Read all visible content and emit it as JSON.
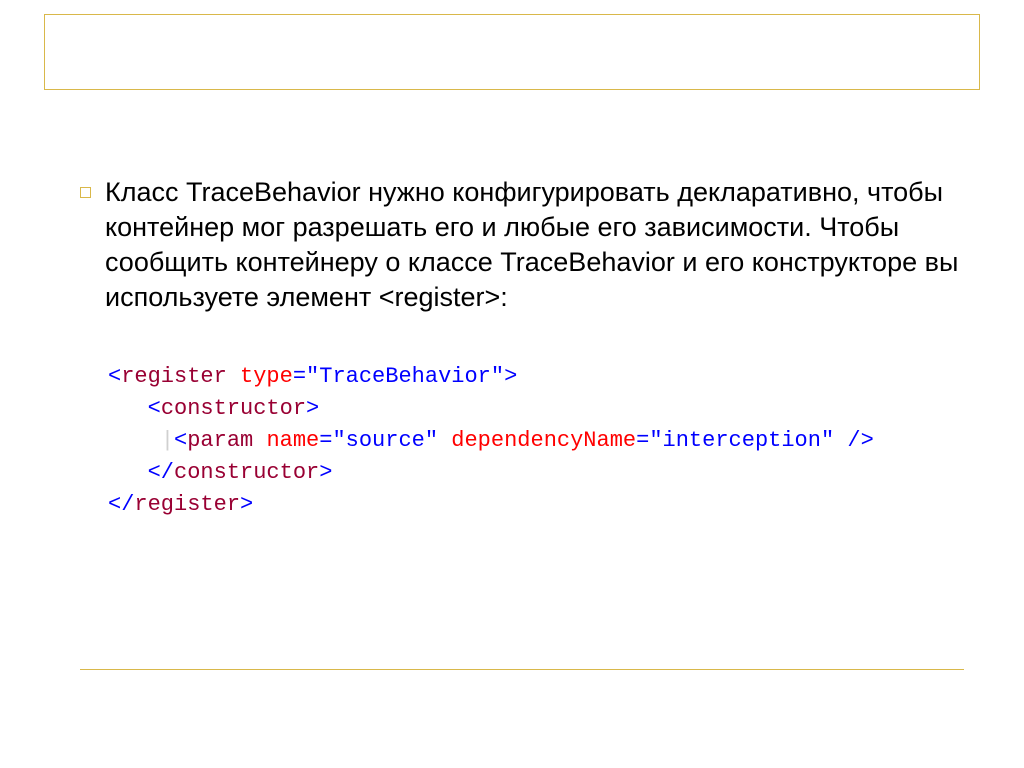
{
  "bullet": {
    "text": "Класс TraceBehavior нужно конфигурировать декларативно, чтобы контейнер мог разрешать его и любые его зависимости. Чтобы сообщить контейнеру о классе TraceBehavior и его конструкторе вы используете элемент <register>:"
  },
  "code": {
    "l1_open": "<",
    "l1_tag": "register",
    "l1_sp": " ",
    "l1_attr1_name": "type",
    "l1_attr1_eq": "=",
    "l1_attr1_val": "\"TraceBehavior\"",
    "l1_close": ">",
    "l2_indent": "   ",
    "l2_open": "<",
    "l2_tag": "constructor",
    "l2_close": ">",
    "l3_indent": "    ",
    "l3_guide": "|",
    "l3_open": "<",
    "l3_tag": "param",
    "l3_sp": " ",
    "l3_attr1_name": "name",
    "l3_attr1_eq": "=",
    "l3_attr1_val": "\"source\"",
    "l3_sp2": " ",
    "l3_attr2_name": "dependencyName",
    "l3_attr2_eq": "=",
    "l3_attr2_val": "\"interception\"",
    "l3_sp3": " ",
    "l3_close": "/>",
    "l4_indent": "   ",
    "l4_open": "</",
    "l4_tag": "constructor",
    "l4_close": ">",
    "l5_open": "</",
    "l5_tag": "register",
    "l5_close": ">"
  }
}
